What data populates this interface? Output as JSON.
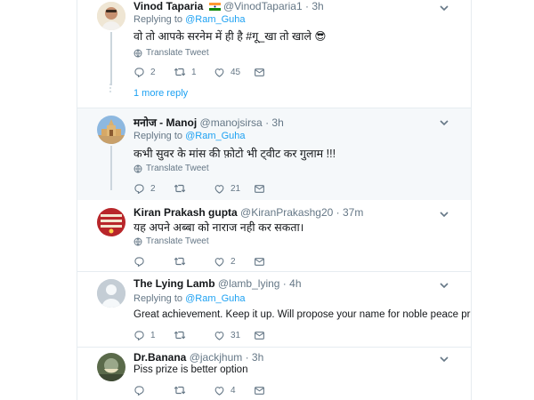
{
  "colors": {
    "link": "#1da1f2",
    "muted": "#657786",
    "text": "#14171a",
    "highlight_bg": "#f5f8fa",
    "border": "#e6ecf0"
  },
  "tweets": [
    {
      "name": "Vinod Taparia",
      "handle": "@VinodTaparia1",
      "sep": "·",
      "time": "3h",
      "flag": "india-flag-emoji",
      "replying_prefix": "Replying to",
      "replying_to": "@Ram_Guha",
      "text": "वो तो आपके सरनेम में ही है #गू_खा तो खाले 😎",
      "translate": "Translate Tweet",
      "replies": "2",
      "retweets": "1",
      "likes": "45"
    },
    {
      "name": "मनोज - Manoj",
      "handle": "@manojsirsa",
      "sep": "·",
      "time": "3h",
      "replying_prefix": "Replying to",
      "replying_to": "@Ram_Guha",
      "text": "कभी सुवर के मांस की फ़ोटो भी ट्वीट कर गुलाम !!!",
      "translate": "Translate Tweet",
      "replies": "2",
      "retweets": "",
      "likes": "21"
    },
    {
      "name": "Kiran Prakash gupta",
      "handle": "@KiranPrakashg20",
      "sep": "·",
      "time": "37m",
      "text": "यह अपने अब्बा को नाराज नही कर सकता।",
      "translate": "Translate Tweet",
      "replies": "",
      "retweets": "",
      "likes": "2"
    },
    {
      "name": "The Lying Lamb",
      "handle": "@lamb_lying",
      "sep": "·",
      "time": "4h",
      "replying_prefix": "Replying to",
      "replying_to": "@Ram_Guha",
      "text": "Great achievement. Keep it up. Will propose your name for noble peace prize...",
      "replies": "1",
      "retweets": "",
      "likes": "31"
    },
    {
      "name": "Dr.Banana",
      "handle": "@jackjhum",
      "sep": "·",
      "time": "3h",
      "text": "Piss prize is better option",
      "replies": "",
      "retweets": "",
      "likes": "4"
    }
  ],
  "more_replies": "1 more reply"
}
